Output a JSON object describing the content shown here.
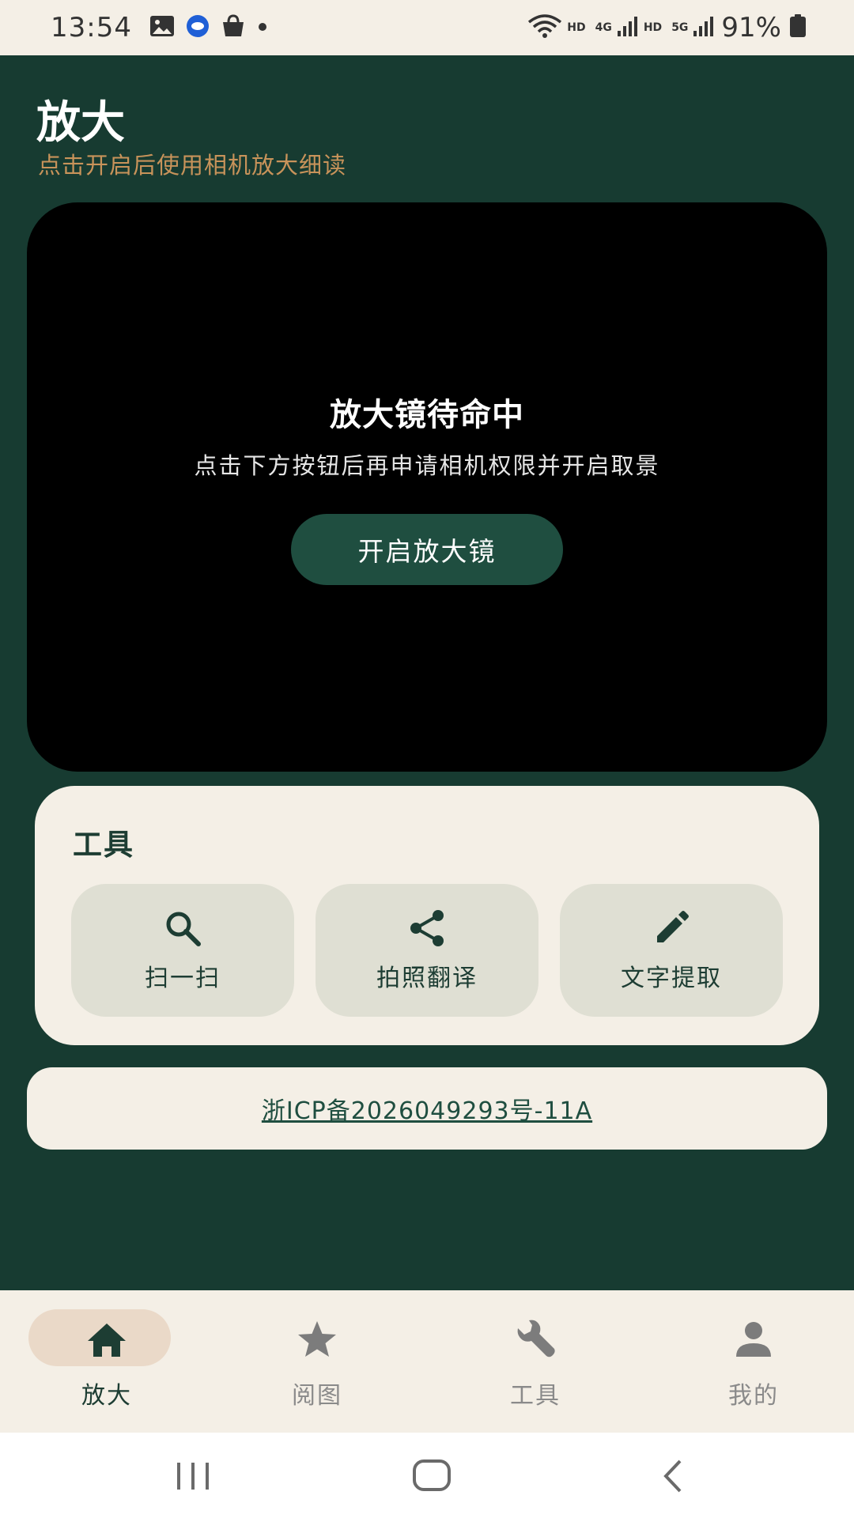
{
  "status_bar": {
    "time": "13:54",
    "network_labels": [
      "HD",
      "4G",
      "HD",
      "5G"
    ],
    "battery": "91%",
    "icons": [
      "image-icon",
      "chat-bubble-icon",
      "shopping-bag-icon",
      "dot-icon",
      "wifi-icon",
      "signal-icon",
      "battery-icon"
    ]
  },
  "header": {
    "title": "放大",
    "subtitle": "点击开启后使用相机放大细读"
  },
  "camera": {
    "title": "放大镜待命中",
    "description": "点击下方按钮后再申请相机权限并开启取景",
    "button_label": "开启放大镜"
  },
  "tools": {
    "title": "工具",
    "items": [
      {
        "label": "扫一扫",
        "icon": "search-icon"
      },
      {
        "label": "拍照翻译",
        "icon": "share-icon"
      },
      {
        "label": "文字提取",
        "icon": "pencil-icon"
      }
    ]
  },
  "icp": {
    "text": "浙ICP备2026049293号-11A"
  },
  "bottom_nav": {
    "active_index": 0,
    "items": [
      {
        "label": "放大",
        "icon": "home-icon"
      },
      {
        "label": "阅图",
        "icon": "star-icon"
      },
      {
        "label": "工具",
        "icon": "wrench-icon"
      },
      {
        "label": "我的",
        "icon": "person-icon"
      }
    ]
  },
  "colors": {
    "background": "#173b31",
    "surface": "#f4efe6",
    "accent": "#1f4e40",
    "subtitle": "#c8935a",
    "active_pill": "#ead9c8",
    "tool_tile": "#dfdfd3"
  },
  "system_nav": {
    "icons": [
      "recents-icon",
      "home-circle-icon",
      "back-icon"
    ]
  }
}
